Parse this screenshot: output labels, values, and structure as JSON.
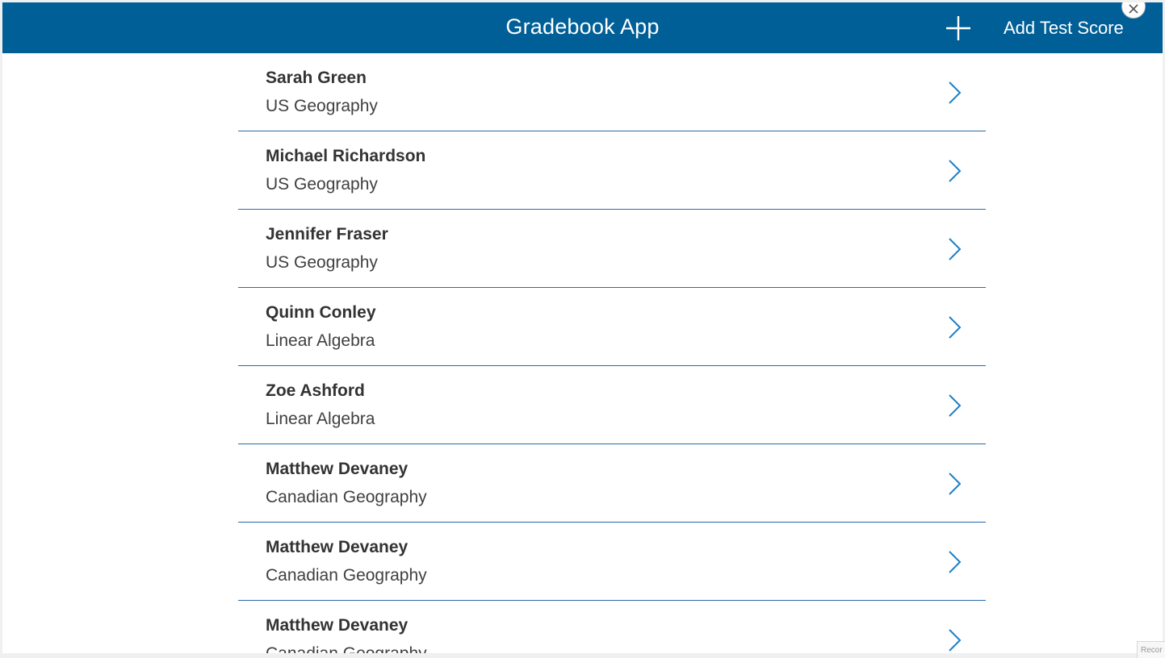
{
  "header": {
    "title": "Gradebook App",
    "add_label": "Add Test Score"
  },
  "colors": {
    "header_bg": "#005f96",
    "accent": "#2a6aa8",
    "chevron": "#1e7fc4"
  },
  "students": [
    {
      "name": "Sarah Green",
      "course": "US Geography"
    },
    {
      "name": "Michael Richardson",
      "course": "US Geography"
    },
    {
      "name": "Jennifer Fraser",
      "course": "US Geography"
    },
    {
      "name": "Quinn Conley",
      "course": "Linear Algebra"
    },
    {
      "name": "Zoe Ashford",
      "course": "Linear Algebra"
    },
    {
      "name": "Matthew Devaney",
      "course": "Canadian Geography"
    },
    {
      "name": "Matthew Devaney",
      "course": "Canadian Geography"
    },
    {
      "name": "Matthew Devaney",
      "course": "Canadian Geography"
    }
  ],
  "corner_text": "Recor"
}
